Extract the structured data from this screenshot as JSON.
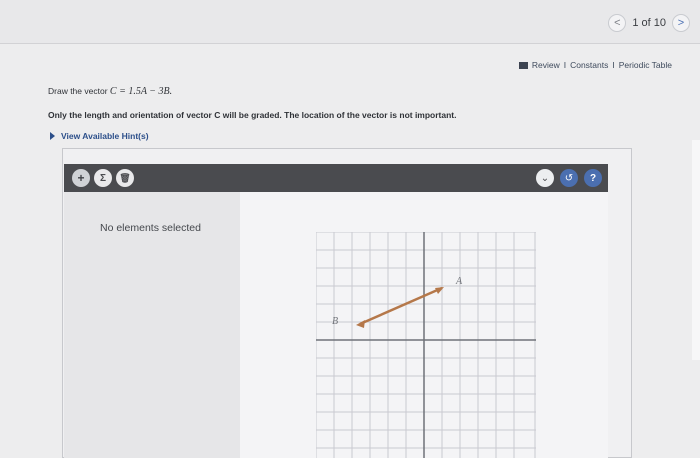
{
  "pager": {
    "prev": "<",
    "text": "1 of 10",
    "next": ">"
  },
  "resources": {
    "review": "Review",
    "sep1": "I",
    "constants": "Constants",
    "sep2": "I",
    "periodic": "Periodic Table"
  },
  "question": {
    "prefix": "Draw the vector",
    "expression": "C = 1.5A − 3B.",
    "note": "Only the length and orientation of vector C will be graded. The location of the vector is not important.",
    "hints": "View Available Hint(s)"
  },
  "toolbar": {
    "add": "+",
    "sum": "Σ",
    "delete": "🗑",
    "dropdown": "⌄",
    "reset": "↺",
    "help": "?"
  },
  "panel": {
    "empty_text": "No elements selected"
  },
  "canvas": {
    "label_a": "A",
    "label_b": "B"
  },
  "colors": {
    "accent": "#4b6fb0",
    "vector": "#b5784a",
    "toolbar": "#4a4b4f"
  }
}
